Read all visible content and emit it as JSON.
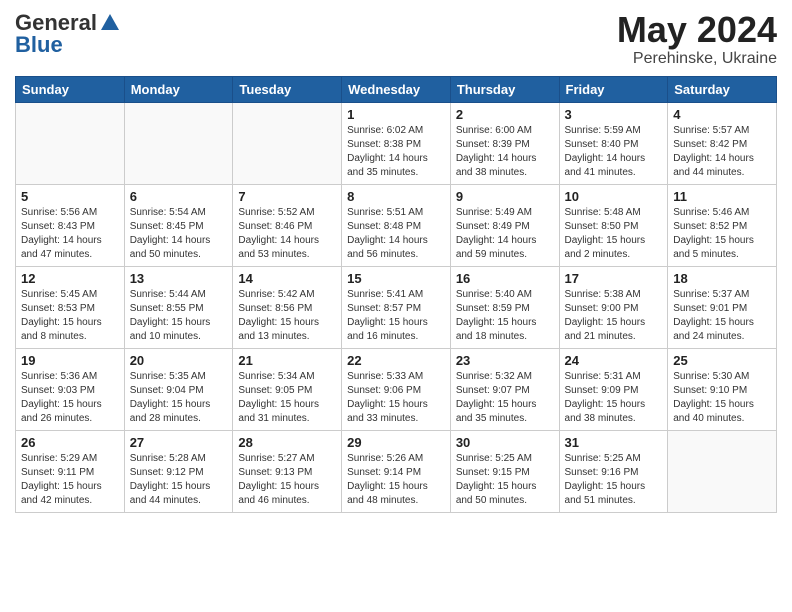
{
  "logo": {
    "general": "General",
    "blue": "Blue"
  },
  "header": {
    "month": "May 2024",
    "location": "Perehinske, Ukraine"
  },
  "weekdays": [
    "Sunday",
    "Monday",
    "Tuesday",
    "Wednesday",
    "Thursday",
    "Friday",
    "Saturday"
  ],
  "weeks": [
    [
      {
        "day": "",
        "info": ""
      },
      {
        "day": "",
        "info": ""
      },
      {
        "day": "",
        "info": ""
      },
      {
        "day": "1",
        "info": "Sunrise: 6:02 AM\nSunset: 8:38 PM\nDaylight: 14 hours\nand 35 minutes."
      },
      {
        "day": "2",
        "info": "Sunrise: 6:00 AM\nSunset: 8:39 PM\nDaylight: 14 hours\nand 38 minutes."
      },
      {
        "day": "3",
        "info": "Sunrise: 5:59 AM\nSunset: 8:40 PM\nDaylight: 14 hours\nand 41 minutes."
      },
      {
        "day": "4",
        "info": "Sunrise: 5:57 AM\nSunset: 8:42 PM\nDaylight: 14 hours\nand 44 minutes."
      }
    ],
    [
      {
        "day": "5",
        "info": "Sunrise: 5:56 AM\nSunset: 8:43 PM\nDaylight: 14 hours\nand 47 minutes."
      },
      {
        "day": "6",
        "info": "Sunrise: 5:54 AM\nSunset: 8:45 PM\nDaylight: 14 hours\nand 50 minutes."
      },
      {
        "day": "7",
        "info": "Sunrise: 5:52 AM\nSunset: 8:46 PM\nDaylight: 14 hours\nand 53 minutes."
      },
      {
        "day": "8",
        "info": "Sunrise: 5:51 AM\nSunset: 8:48 PM\nDaylight: 14 hours\nand 56 minutes."
      },
      {
        "day": "9",
        "info": "Sunrise: 5:49 AM\nSunset: 8:49 PM\nDaylight: 14 hours\nand 59 minutes."
      },
      {
        "day": "10",
        "info": "Sunrise: 5:48 AM\nSunset: 8:50 PM\nDaylight: 15 hours\nand 2 minutes."
      },
      {
        "day": "11",
        "info": "Sunrise: 5:46 AM\nSunset: 8:52 PM\nDaylight: 15 hours\nand 5 minutes."
      }
    ],
    [
      {
        "day": "12",
        "info": "Sunrise: 5:45 AM\nSunset: 8:53 PM\nDaylight: 15 hours\nand 8 minutes."
      },
      {
        "day": "13",
        "info": "Sunrise: 5:44 AM\nSunset: 8:55 PM\nDaylight: 15 hours\nand 10 minutes."
      },
      {
        "day": "14",
        "info": "Sunrise: 5:42 AM\nSunset: 8:56 PM\nDaylight: 15 hours\nand 13 minutes."
      },
      {
        "day": "15",
        "info": "Sunrise: 5:41 AM\nSunset: 8:57 PM\nDaylight: 15 hours\nand 16 minutes."
      },
      {
        "day": "16",
        "info": "Sunrise: 5:40 AM\nSunset: 8:59 PM\nDaylight: 15 hours\nand 18 minutes."
      },
      {
        "day": "17",
        "info": "Sunrise: 5:38 AM\nSunset: 9:00 PM\nDaylight: 15 hours\nand 21 minutes."
      },
      {
        "day": "18",
        "info": "Sunrise: 5:37 AM\nSunset: 9:01 PM\nDaylight: 15 hours\nand 24 minutes."
      }
    ],
    [
      {
        "day": "19",
        "info": "Sunrise: 5:36 AM\nSunset: 9:03 PM\nDaylight: 15 hours\nand 26 minutes."
      },
      {
        "day": "20",
        "info": "Sunrise: 5:35 AM\nSunset: 9:04 PM\nDaylight: 15 hours\nand 28 minutes."
      },
      {
        "day": "21",
        "info": "Sunrise: 5:34 AM\nSunset: 9:05 PM\nDaylight: 15 hours\nand 31 minutes."
      },
      {
        "day": "22",
        "info": "Sunrise: 5:33 AM\nSunset: 9:06 PM\nDaylight: 15 hours\nand 33 minutes."
      },
      {
        "day": "23",
        "info": "Sunrise: 5:32 AM\nSunset: 9:07 PM\nDaylight: 15 hours\nand 35 minutes."
      },
      {
        "day": "24",
        "info": "Sunrise: 5:31 AM\nSunset: 9:09 PM\nDaylight: 15 hours\nand 38 minutes."
      },
      {
        "day": "25",
        "info": "Sunrise: 5:30 AM\nSunset: 9:10 PM\nDaylight: 15 hours\nand 40 minutes."
      }
    ],
    [
      {
        "day": "26",
        "info": "Sunrise: 5:29 AM\nSunset: 9:11 PM\nDaylight: 15 hours\nand 42 minutes."
      },
      {
        "day": "27",
        "info": "Sunrise: 5:28 AM\nSunset: 9:12 PM\nDaylight: 15 hours\nand 44 minutes."
      },
      {
        "day": "28",
        "info": "Sunrise: 5:27 AM\nSunset: 9:13 PM\nDaylight: 15 hours\nand 46 minutes."
      },
      {
        "day": "29",
        "info": "Sunrise: 5:26 AM\nSunset: 9:14 PM\nDaylight: 15 hours\nand 48 minutes."
      },
      {
        "day": "30",
        "info": "Sunrise: 5:25 AM\nSunset: 9:15 PM\nDaylight: 15 hours\nand 50 minutes."
      },
      {
        "day": "31",
        "info": "Sunrise: 5:25 AM\nSunset: 9:16 PM\nDaylight: 15 hours\nand 51 minutes."
      },
      {
        "day": "",
        "info": ""
      }
    ]
  ]
}
